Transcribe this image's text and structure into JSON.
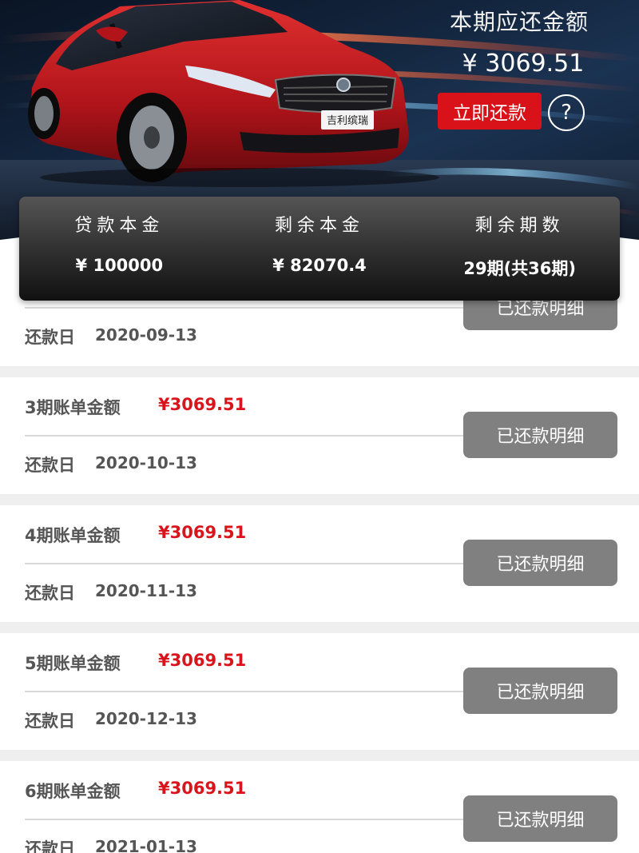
{
  "header": {
    "due_label": "本期应还金额",
    "due_amount": "¥ 3069.51",
    "pay_button": "立即还款",
    "help_icon": "question-circle-icon",
    "car_badge": "吉利缤瑞"
  },
  "summary": [
    {
      "label": "贷款本金",
      "value": "¥ 100000"
    },
    {
      "label": "剩余本金",
      "value": "¥ 82070.4"
    },
    {
      "label": "剩余期数",
      "value": "29期(共36期)"
    }
  ],
  "bills": [
    {
      "title": "",
      "amount": "",
      "date_label": "还款日",
      "date": "2020-09-13",
      "button": "已还款明细"
    },
    {
      "title": "3期账单金额",
      "amount": "¥3069.51",
      "date_label": "还款日",
      "date": "2020-10-13",
      "button": "已还款明细"
    },
    {
      "title": "4期账单金额",
      "amount": "¥3069.51",
      "date_label": "还款日",
      "date": "2020-11-13",
      "button": "已还款明细"
    },
    {
      "title": "5期账单金额",
      "amount": "¥3069.51",
      "date_label": "还款日",
      "date": "2020-12-13",
      "button": "已还款明细"
    },
    {
      "title": "6期账单金额",
      "amount": "¥3069.51",
      "date_label": "还款日",
      "date": "2021-01-13",
      "button": "已还款明细"
    }
  ],
  "colors": {
    "accent_red": "#d9121a",
    "amount_red": "#d8151b",
    "button_gray": "#808080"
  }
}
